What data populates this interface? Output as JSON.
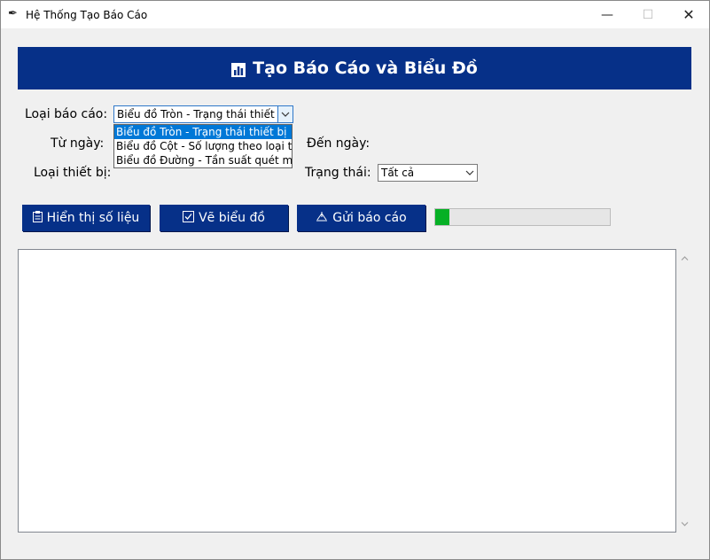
{
  "window": {
    "title": "Hệ Thống Tạo Báo Cáo",
    "minimize": "—",
    "maximize": "☐",
    "close": "✕"
  },
  "header": {
    "title": "Tạo Báo Cáo và Biểu Đồ"
  },
  "form": {
    "report_type_label": "Loại báo cáo:",
    "report_type_value": "Biểu đồ Tròn - Trạng thái thiết bị",
    "report_type_options": [
      "Biểu đồ Tròn - Trạng thái thiết bị",
      "Biểu đồ Cột - Số lượng theo loại thiết",
      "Biểu đồ Đường - Tần suất quét mã"
    ],
    "from_date_label": "Từ ngày:",
    "to_date_label": "Đến ngày:",
    "device_type_label": "Loại thiết bị:",
    "status_label": "Trạng thái:",
    "status_value": "Tất cả"
  },
  "buttons": {
    "show_data": "Hiển thị số liệu",
    "draw_chart": "Vẽ biểu đồ",
    "send_report": "Gửi báo cáo"
  },
  "progress": {
    "value": 0.08,
    "color": "#06b025"
  },
  "colors": {
    "accent": "#063088",
    "selection": "#0078d7"
  },
  "icons": {
    "app": "feather-icon",
    "header": "bar-chart-icon",
    "show_data": "clipboard-icon",
    "draw_chart": "checkbox-icon",
    "send_report": "send-icon"
  }
}
